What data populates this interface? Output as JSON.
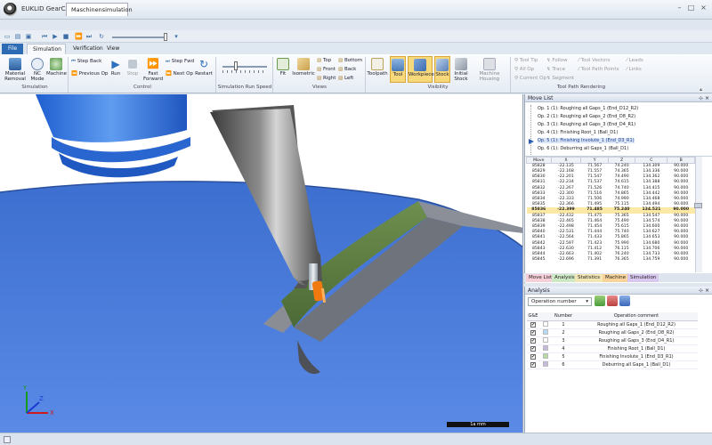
{
  "window": {
    "app_title": "EUKLID GearCAM",
    "doc_tab": "Maschinensimulation"
  },
  "ribbon_tabs": [
    "File",
    "Simulation",
    "Verification",
    "View"
  ],
  "ribbon": {
    "simulation": {
      "material_removal": "Material\nRemoval",
      "nc_mode": "NC\nMode",
      "machine": "Machine",
      "label": "Simulation"
    },
    "control": {
      "step_back": "Step Back",
      "previous_op": "Previous Op",
      "run": "Run",
      "stop": "Stop",
      "fast_forward": "Fast\nForward",
      "step_fwd": "Step Fwd",
      "next_op": "Next Op",
      "restart": "Restart",
      "label": "Control"
    },
    "speed": {
      "label": "Simulation Run Speed",
      "value_fraction": 0.25
    },
    "views": {
      "fit": "Fit",
      "isometric": "Isometric",
      "top": "Top",
      "front": "Front",
      "right": "Right",
      "bottom": "Bottom",
      "back": "Back",
      "left": "Left",
      "label": "Views"
    },
    "visibility": {
      "toolpath": "Toolpath",
      "tool": "Tool",
      "workpiece": "Workpiece",
      "stock": "Stock",
      "initial_stock": "Initial\nStock",
      "machine_housing": "Machine Housing",
      "label": "Visibility"
    },
    "rendering": {
      "tool_tip": "Tool Tip",
      "all_op": "All Op",
      "current_op": "Current Op",
      "follow": "Follow",
      "trace": "Trace",
      "segment": "Segment",
      "tool_vectors": "Tool Vectors",
      "tool_path_points": "Tool Path Points",
      "leads": "Leads",
      "links": "Links",
      "label": "Tool Path Rendering"
    }
  },
  "viewport": {
    "scale_label": "1a mm",
    "axes": {
      "x": "X",
      "y": "Y",
      "z": "Z"
    }
  },
  "move_list": {
    "title": "Move List",
    "operations": [
      "Op. 1 (1): Roughing all Gaps_1 (End_D12_R2)",
      "Op. 2 (1): Roughing all Gaps_2 (End_D8_R2)",
      "Op. 3 (1): Roughing all Gaps_3 (End_D4_R1)",
      "Op. 4 (1): Finishing Root_1 (Ball_D1)",
      "Op. 5 (1): Finishing Involute_1 (End_D3_R1)",
      "Op. 6 (1): Deburring all Gaps_1 (Ball_D1)"
    ],
    "active_op": 4,
    "columns": [
      "Move",
      "X",
      "Y",
      "Z",
      "C",
      "B"
    ],
    "rows": [
      [
        "85828",
        "-22.135",
        "71.567",
        "74.240",
        "134.309",
        "90.000"
      ],
      [
        "85829",
        "-22.168",
        "71.557",
        "74.365",
        "134.336",
        "90.000"
      ],
      [
        "85830",
        "-22.201",
        "71.547",
        "74.490",
        "134.362",
        "90.000"
      ],
      [
        "85831",
        "-22.234",
        "71.537",
        "74.615",
        "134.388",
        "90.000"
      ],
      [
        "85832",
        "-22.267",
        "71.526",
        "74.740",
        "134.415",
        "90.000"
      ],
      [
        "85833",
        "-22.300",
        "71.516",
        "74.865",
        "134.442",
        "90.000"
      ],
      [
        "85834",
        "-22.333",
        "71.506",
        "74.990",
        "134.468",
        "90.000"
      ],
      [
        "85835",
        "-22.366",
        "71.495",
        "75.115",
        "134.494",
        "90.000"
      ],
      [
        "85836",
        "-22.399",
        "71.485",
        "75.240",
        "134.521",
        "90.000"
      ],
      [
        "85837",
        "-22.432",
        "71.475",
        "75.365",
        "134.547",
        "90.000"
      ],
      [
        "85838",
        "-22.465",
        "71.464",
        "75.490",
        "134.574",
        "90.000"
      ],
      [
        "85839",
        "-22.498",
        "71.454",
        "75.615",
        "134.600",
        "90.000"
      ],
      [
        "85840",
        "-22.531",
        "71.444",
        "75.740",
        "134.627",
        "90.000"
      ],
      [
        "85841",
        "-22.564",
        "71.433",
        "75.865",
        "134.653",
        "90.000"
      ],
      [
        "85842",
        "-22.597",
        "71.423",
        "75.990",
        "134.680",
        "90.000"
      ],
      [
        "85843",
        "-22.630",
        "71.412",
        "76.115",
        "134.706",
        "90.000"
      ],
      [
        "85844",
        "-22.663",
        "71.402",
        "76.240",
        "134.733",
        "90.000"
      ],
      [
        "85845",
        "-22.696",
        "71.391",
        "76.365",
        "134.759",
        "90.000"
      ]
    ],
    "current_row": 8,
    "bottom_tabs": [
      "Move List",
      "Analysis",
      "Statistics",
      "Machine",
      "Simulation"
    ]
  },
  "analysis": {
    "title": "Analysis",
    "select_value": "Operation number",
    "columns": [
      "G&E",
      "Number",
      "Operation comment"
    ],
    "rows": [
      {
        "checked": "✔",
        "color": "#ffffff",
        "number": "1",
        "comment": "Roughing all Gaps_1 (End_D12_R2)"
      },
      {
        "checked": "✔",
        "color": "#b4dcf2",
        "number": "2",
        "comment": "Roughing all Gaps_2 (End_D8_R2)"
      },
      {
        "checked": "✔",
        "color": "#ffffff",
        "number": "3",
        "comment": "Roughing all Gaps_3 (End_D4_R1)"
      },
      {
        "checked": "✔",
        "color": "#c8b8e0",
        "number": "4",
        "comment": "Finishing Root_1 (Ball_D1)"
      },
      {
        "checked": "✔",
        "color": "#b5dba0",
        "number": "5",
        "comment": "Finishing Involute_1 (End_D3_R1)"
      },
      {
        "checked": "✔",
        "color": "#c8b8e0",
        "number": "6",
        "comment": "Deburring all Gaps_1 (Ball_D1)"
      }
    ]
  },
  "colors": {
    "accent": "#2d6bb5",
    "workpiece": "#4a7bd8",
    "highlight": "#f7d97c"
  }
}
